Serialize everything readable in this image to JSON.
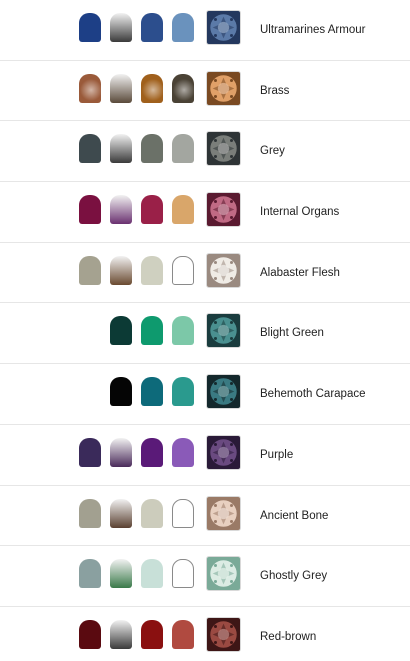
{
  "schemes": [
    {
      "name": "Ultramarines Armour",
      "pots": [
        {
          "fill": "#1d3f86",
          "style": "solid"
        },
        {
          "fill": "#3a3a3a",
          "style": "shade"
        },
        {
          "fill": "#2c4e8d",
          "style": "solid"
        },
        {
          "fill": "#6a92bd",
          "style": "solid"
        }
      ],
      "swatch": {
        "base": "#5b7aa8",
        "dark": "#24385e"
      }
    },
    {
      "name": "Brass",
      "pots": [
        {
          "fill": "#9a5a3a",
          "style": "metal"
        },
        {
          "fill": "#5a4a3a",
          "style": "shade"
        },
        {
          "fill": "#a0601c",
          "style": "metal"
        },
        {
          "fill": "#4a4235",
          "style": "metal"
        }
      ],
      "swatch": {
        "base": "#e0a068",
        "dark": "#7a4a22"
      }
    },
    {
      "name": "Grey",
      "pots": [
        {
          "fill": "#3e4a4e",
          "style": "solid"
        },
        {
          "fill": "#3a3a3a",
          "style": "shade"
        },
        {
          "fill": "#6b7168",
          "style": "solid"
        },
        {
          "fill": "#a3a6a0",
          "style": "solid"
        }
      ],
      "swatch": {
        "base": "#7a7e7a",
        "dark": "#2e3436"
      }
    },
    {
      "name": "Internal Organs",
      "pots": [
        {
          "fill": "#7a1040",
          "style": "solid"
        },
        {
          "fill": "#6a3070",
          "style": "shade"
        },
        {
          "fill": "#9a2048",
          "style": "solid"
        },
        {
          "fill": "#d9a66a",
          "style": "solid"
        }
      ],
      "swatch": {
        "base": "#c06a84",
        "dark": "#5a1a30"
      }
    },
    {
      "name": "Alabaster Flesh",
      "pots": [
        {
          "fill": "#a5a290",
          "style": "solid"
        },
        {
          "fill": "#6a4a30",
          "style": "shade"
        },
        {
          "fill": "#cfd0c0",
          "style": "solid"
        },
        {
          "fill": "#ffffff",
          "style": "outline"
        }
      ],
      "swatch": {
        "base": "#f0ece6",
        "dark": "#9a8a80"
      }
    },
    {
      "name": "Blight Green",
      "pots": [
        {
          "fill": "",
          "style": "none"
        },
        {
          "fill": "#0c3a35",
          "style": "solid"
        },
        {
          "fill": "#0e9a6e",
          "style": "solid"
        },
        {
          "fill": "#7cc8a8",
          "style": "solid"
        }
      ],
      "swatch": {
        "base": "#4a9090",
        "dark": "#1a3c3e"
      }
    },
    {
      "name": "Behemoth Carapace",
      "pots": [
        {
          "fill": "",
          "style": "none"
        },
        {
          "fill": "#050505",
          "style": "solid"
        },
        {
          "fill": "#0d6a7a",
          "style": "solid"
        },
        {
          "fill": "#2a9a8e",
          "style": "solid"
        }
      ],
      "swatch": {
        "base": "#3a7a82",
        "dark": "#14282c"
      }
    },
    {
      "name": "Purple",
      "pots": [
        {
          "fill": "#3a2a5a",
          "style": "solid"
        },
        {
          "fill": "#4a2a5a",
          "style": "shade"
        },
        {
          "fill": "#5a1a78",
          "style": "solid"
        },
        {
          "fill": "#8a5ab8",
          "style": "solid"
        }
      ],
      "swatch": {
        "base": "#6a4a80",
        "dark": "#2a1a38"
      }
    },
    {
      "name": "Ancient Bone",
      "pots": [
        {
          "fill": "#a2a090",
          "style": "solid"
        },
        {
          "fill": "#5a4030",
          "style": "shade"
        },
        {
          "fill": "#ccccbc",
          "style": "solid"
        },
        {
          "fill": "#ffffff",
          "style": "outline"
        }
      ],
      "swatch": {
        "base": "#e8d0c0",
        "dark": "#9a7a66"
      }
    },
    {
      "name": "Ghostly Grey",
      "pots": [
        {
          "fill": "#8aa0a0",
          "style": "solid"
        },
        {
          "fill": "#3a7a4a",
          "style": "shade"
        },
        {
          "fill": "#c8e0d8",
          "style": "solid"
        },
        {
          "fill": "#ffffff",
          "style": "outline"
        }
      ],
      "swatch": {
        "base": "#dcece4",
        "dark": "#7aaa98"
      }
    },
    {
      "name": "Red-brown",
      "pots": [
        {
          "fill": "#5a0a10",
          "style": "solid"
        },
        {
          "fill": "#3a3a3a",
          "style": "shade"
        },
        {
          "fill": "#8a1010",
          "style": "solid"
        },
        {
          "fill": "#b04a40",
          "style": "solid"
        }
      ],
      "swatch": {
        "base": "#9a4a42",
        "dark": "#3e1616"
      }
    }
  ]
}
